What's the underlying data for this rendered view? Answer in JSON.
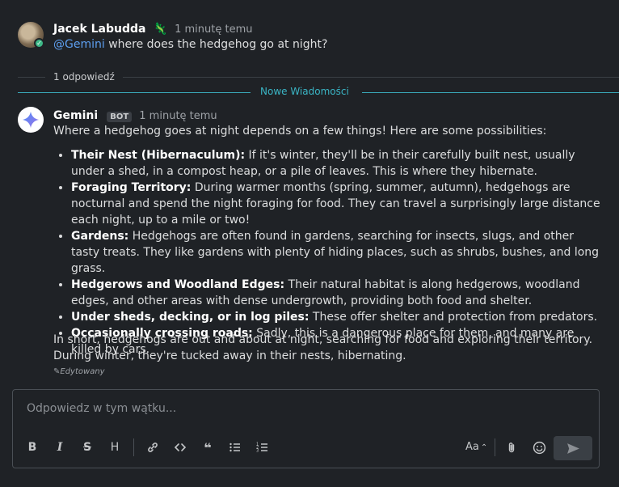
{
  "user_message": {
    "author": "Jacek Labudda",
    "author_emoji": "🦎",
    "time": "1 minutę temu",
    "mention": "@Gemini",
    "text": " where does the hedgehog go at night?"
  },
  "thread": {
    "reply_count": "1 odpowiedź",
    "new_messages_label": "Nowe Wiadomości"
  },
  "bot_message": {
    "author": "Gemini",
    "badge": "BOT",
    "time": "1 minutę temu",
    "intro": "Where a hedgehog goes at night depends on a few things! Here are some possibilities:",
    "items": [
      {
        "title": "Their Nest (Hibernaculum):",
        "text": " If it's winter, they'll be in their carefully built nest, usually under a shed, in a compost heap, or a pile of leaves. This is where they hibernate."
      },
      {
        "title": "Foraging Territory:",
        "text": " During warmer months (spring, summer, autumn), hedgehogs are nocturnal and spend the night foraging for food. They can travel a surprisingly large distance each night, up to a mile or two!"
      },
      {
        "title": "Gardens:",
        "text": " Hedgehogs are often found in gardens, searching for insects, slugs, and other tasty treats. They like gardens with plenty of hiding places, such as shrubs, bushes, and long grass."
      },
      {
        "title": "Hedgerows and Woodland Edges:",
        "text": " Their natural habitat is along hedgerows, woodland edges, and other areas with dense undergrowth, providing both food and shelter."
      },
      {
        "title": "Under sheds, decking, or in log piles:",
        "text": " These offer shelter and protection from predators."
      },
      {
        "title": "Occasionally crossing roads:",
        "text": " Sadly, this is a dangerous place for them, and many are killed by cars."
      }
    ],
    "outro": "In short, hedgehogs are out and about at night, searching for food and exploring their territory. During winter, they're tucked away in their nests, hibernating.",
    "edited_label": "Edytowany"
  },
  "composer": {
    "placeholder": "Odpowiedz w tym wątku...",
    "format_label": "Aa"
  },
  "colors": {
    "background": "#1f2226",
    "mention": "#5d9ff0",
    "new_messages": "#3ab5c5",
    "online": "#3db887"
  }
}
